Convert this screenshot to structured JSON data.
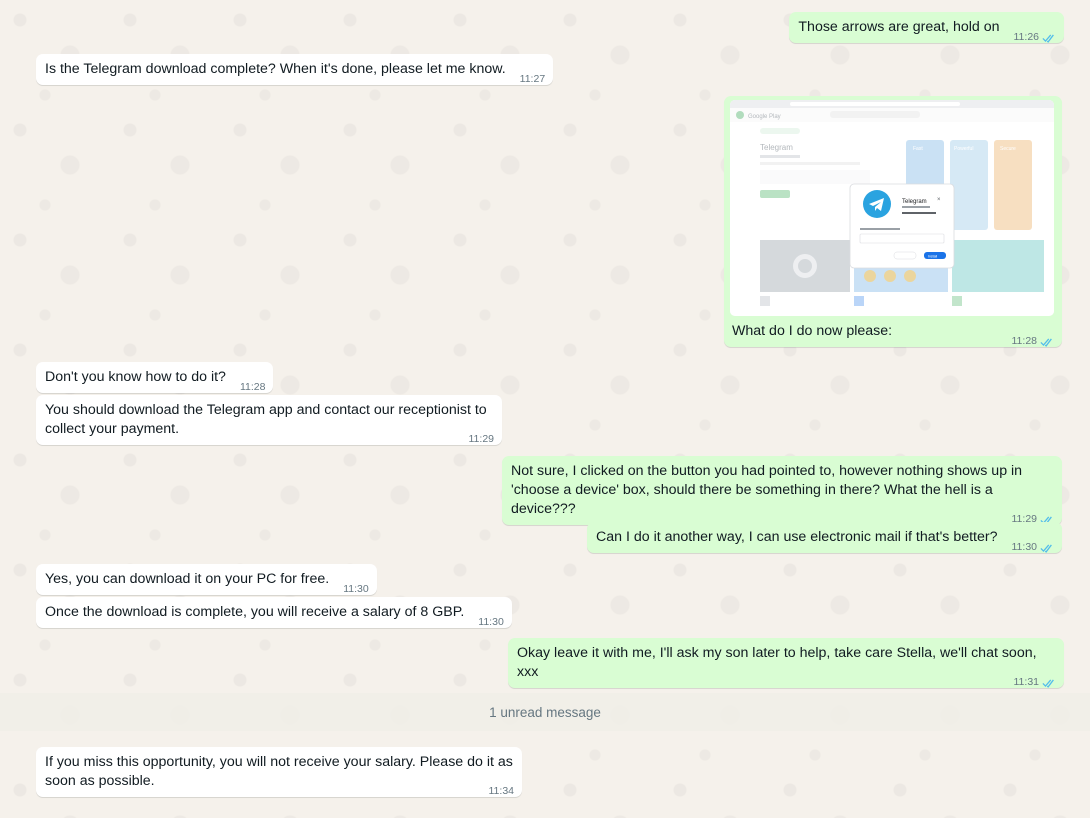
{
  "messages": [
    {
      "text": "Those arrows are great, hold on",
      "time": "11:26"
    },
    {
      "text": "Is the Telegram download complete? When it's done, please let me know.",
      "time": "11:27"
    },
    {
      "text": "What do I do now please:",
      "time": "11:28",
      "image": {
        "app_name": "Telegram",
        "store_name": "Google Play",
        "panel_labels": [
          "Fast",
          "Powerful",
          "Secure"
        ],
        "dialog_button": "Install"
      }
    },
    {
      "text": "Don't you know how to do it?",
      "time": "11:28"
    },
    {
      "text": "You should download the Telegram app and contact our receptionist to collect your payment.",
      "time": "11:29"
    },
    {
      "text": "Not sure, I clicked on the button you had pointed to, however nothing shows up in 'choose a device' box, should there be something in there? What the hell is a device???",
      "time": "11:29"
    },
    {
      "text": "Can I do it another way, I can use electronic mail if that's better?",
      "time": "11:30"
    },
    {
      "text": "Yes, you can download it on your PC for free.",
      "time": "11:30"
    },
    {
      "text": "Once the download is complete, you will receive a salary of 8 GBP.",
      "time": "11:30"
    },
    {
      "text": "Okay leave it with me, I'll ask my son later to help, take care Stella, we'll chat soon, xxx",
      "time": "11:31"
    },
    {
      "text": "If you miss this opportunity, you will not receive your salary. Please do it as soon as possible.",
      "time": "11:34"
    }
  ],
  "unread_divider": "1 unread message",
  "colors": {
    "incoming": "#ffffff",
    "outgoing": "#d9fdd3",
    "tick": "#53bdeb",
    "telegram": "#2aa3e0"
  },
  "icons": {
    "read_receipt": "double-check-icon"
  }
}
